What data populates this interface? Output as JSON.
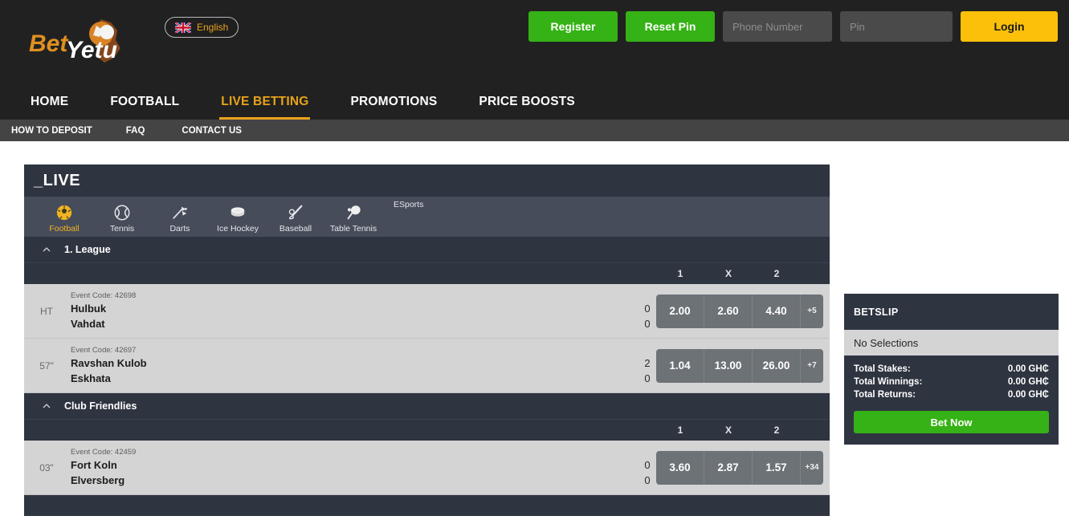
{
  "brand": {
    "name_part1": "Bet",
    "name_part2": "Yetu"
  },
  "language": {
    "label": "English",
    "flag": "uk-flag-icon"
  },
  "header": {
    "register_label": "Register",
    "reset_pin_label": "Reset Pin",
    "phone_placeholder": "Phone Number",
    "phone_value": "",
    "pin_placeholder": "Pin",
    "pin_value": "",
    "login_label": "Login"
  },
  "nav": {
    "items": [
      {
        "label": "HOME",
        "active": false
      },
      {
        "label": "FOOTBALL",
        "active": false
      },
      {
        "label": "LIVE BETTING",
        "active": true
      },
      {
        "label": "PROMOTIONS",
        "active": false
      },
      {
        "label": "PRICE BOOSTS",
        "active": false
      }
    ]
  },
  "subnav": {
    "items": [
      {
        "label": "HOW TO DEPOSIT"
      },
      {
        "label": "FAQ"
      },
      {
        "label": "CONTACT US"
      }
    ]
  },
  "main": {
    "title": "_LIVE",
    "sports": [
      {
        "label": "Football",
        "icon": "football-icon",
        "active": true
      },
      {
        "label": "Tennis",
        "icon": "tennis-icon",
        "active": false
      },
      {
        "label": "Darts",
        "icon": "darts-icon",
        "active": false
      },
      {
        "label": "Ice Hockey",
        "icon": "ice-hockey-icon",
        "active": false
      },
      {
        "label": "Baseball",
        "icon": "baseball-icon",
        "active": false
      },
      {
        "label": "Table Tennis",
        "icon": "table-tennis-icon",
        "active": false
      }
    ],
    "esports_label": "ESports",
    "odds_columns": [
      "1",
      "X",
      "2"
    ],
    "leagues": [
      {
        "name": "1. League",
        "matches": [
          {
            "time": "HT",
            "event_code": "Event Code: 42698",
            "home": "Hulbuk",
            "away": "Vahdat",
            "score_home": "0",
            "score_away": "0",
            "odds": [
              "2.00",
              "2.60",
              "4.40"
            ],
            "more": "+5"
          },
          {
            "time": "57\"",
            "event_code": "Event Code: 42697",
            "home": "Ravshan Kulob",
            "away": "Eskhata",
            "score_home": "2",
            "score_away": "0",
            "odds": [
              "1.04",
              "13.00",
              "26.00"
            ],
            "more": "+7"
          }
        ]
      },
      {
        "name": "Club Friendlies",
        "matches": [
          {
            "time": "03\"",
            "event_code": "Event Code: 42459",
            "home": "Fort Koln",
            "away": "Elversberg",
            "score_home": "0",
            "score_away": "0",
            "odds": [
              "3.60",
              "2.87",
              "1.57"
            ],
            "more": "+34"
          }
        ]
      }
    ]
  },
  "betslip": {
    "title": "BETSLIP",
    "empty_text": "No Selections",
    "totals": [
      {
        "label": "Total Stakes:",
        "value": "0.00 GH₵"
      },
      {
        "label": "Total Winnings:",
        "value": "0.00 GH₵"
      },
      {
        "label": "Total Returns:",
        "value": "0.00 GH₵"
      }
    ],
    "bet_now_label": "Bet Now"
  },
  "colors": {
    "accent": "#e9a31b",
    "green": "#35b215",
    "login_yellow": "#fcc00a",
    "panel_dark": "#2f3441",
    "row_light": "#d4d4d4",
    "odds_gray": "#6d7277"
  }
}
